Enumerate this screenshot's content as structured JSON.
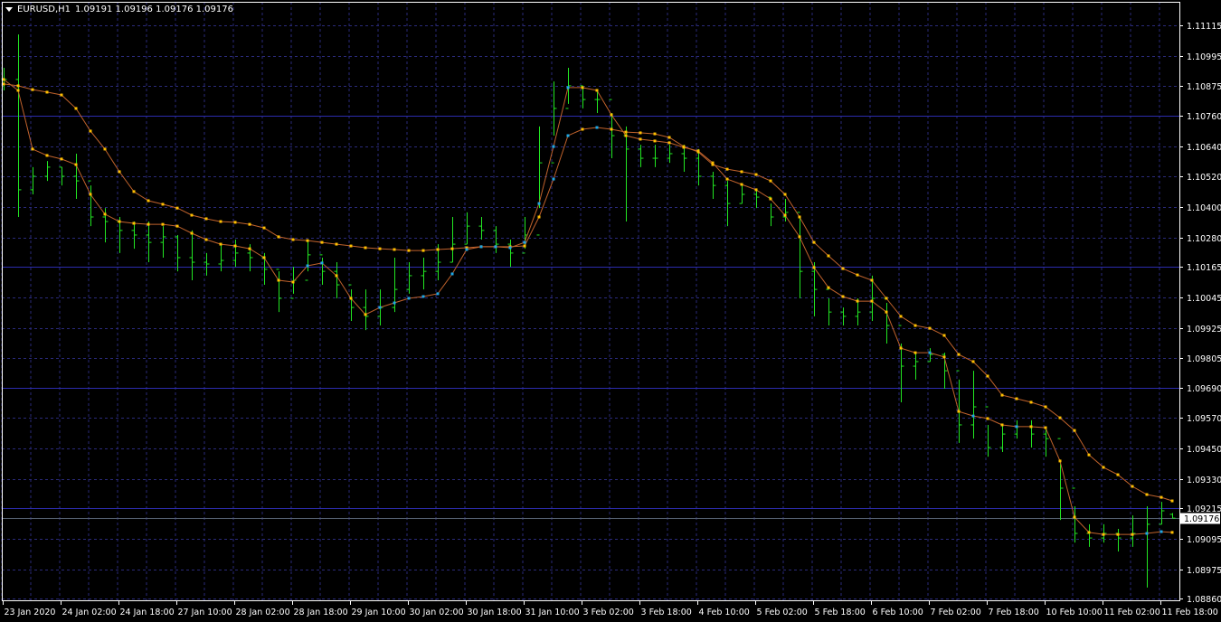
{
  "header": {
    "symbol": "EURUSD,H1",
    "ohlc": "1.09191 1.09196 1.09176 1.09176",
    "menu_icon": "triangle-down-icon"
  },
  "colors": {
    "background": "#000000",
    "bars": "#22e622",
    "grid": "#2a2a7a",
    "level_lines": "#2c2cae",
    "current_price_line": "#556070",
    "indicator_line": "#c0622c",
    "dot_down": "#ffc000",
    "dot_up": "#1ea8e6",
    "frame": "#ffffff"
  },
  "chart_data": {
    "type": "ohlc-bar",
    "symbol": "EURUSD",
    "timeframe": "H1",
    "ylim": [
      1.0886,
      1.11115
    ],
    "grid": true,
    "current_price": "1.09176",
    "y_ticks": [
      "1.11115",
      "1.10995",
      "1.10875",
      "1.10760",
      "1.10640",
      "1.10520",
      "1.10400",
      "1.10280",
      "1.10165",
      "1.10045",
      "1.09925",
      "1.09805",
      "1.09690",
      "1.09570",
      "1.09450",
      "1.09330",
      "1.09215",
      "1.09095",
      "1.08975",
      "1.08860"
    ],
    "x_ticks": [
      "23 Jan 2020",
      "24 Jan 02:00",
      "24 Jan 18:00",
      "27 Jan 10:00",
      "28 Jan 02:00",
      "28 Jan 18:00",
      "29 Jan 10:00",
      "30 Jan 02:00",
      "30 Jan 18:00",
      "31 Jan 10:00",
      "3 Feb 02:00",
      "3 Feb 18:00",
      "4 Feb 10:00",
      "5 Feb 02:00",
      "5 Feb 18:00",
      "6 Feb 10:00",
      "7 Feb 02:00",
      "7 Feb 18:00",
      "10 Feb 10:00",
      "11 Feb 02:00",
      "11 Feb 18:00"
    ],
    "levels": [
      1.1076,
      1.10165,
      1.0969,
      1.09215
    ],
    "time": [
      "23 Jan 10:00",
      "23 Jan 14:00",
      "23 Jan 18:00",
      "23 Jan 22:00",
      "24 Jan 02:00",
      "24 Jan 06:00",
      "24 Jan 10:00",
      "24 Jan 14:00",
      "24 Jan 18:00",
      "24 Jan 22:00",
      "27 Jan 02:00",
      "27 Jan 06:00",
      "27 Jan 10:00",
      "27 Jan 14:00",
      "27 Jan 18:00",
      "27 Jan 22:00",
      "28 Jan 02:00",
      "28 Jan 06:00",
      "28 Jan 10:00",
      "28 Jan 14:00",
      "28 Jan 18:00",
      "28 Jan 22:00",
      "29 Jan 02:00",
      "29 Jan 06:00",
      "29 Jan 10:00",
      "29 Jan 14:00",
      "29 Jan 18:00",
      "29 Jan 22:00",
      "30 Jan 02:00",
      "30 Jan 06:00",
      "30 Jan 10:00",
      "30 Jan 14:00",
      "30 Jan 18:00",
      "30 Jan 22:00",
      "31 Jan 02:00",
      "31 Jan 06:00",
      "31 Jan 10:00",
      "31 Jan 14:00",
      "31 Jan 18:00",
      "31 Jan 22:00",
      "3 Feb 02:00",
      "3 Feb 06:00",
      "3 Feb 10:00",
      "3 Feb 14:00",
      "3 Feb 18:00",
      "3 Feb 22:00",
      "4 Feb 02:00",
      "4 Feb 06:00",
      "4 Feb 10:00",
      "4 Feb 14:00",
      "4 Feb 18:00",
      "4 Feb 22:00",
      "5 Feb 02:00",
      "5 Feb 06:00",
      "5 Feb 10:00",
      "5 Feb 14:00",
      "5 Feb 18:00",
      "5 Feb 22:00",
      "6 Feb 02:00",
      "6 Feb 06:00",
      "6 Feb 10:00",
      "6 Feb 14:00",
      "6 Feb 18:00",
      "6 Feb 22:00",
      "7 Feb 02:00",
      "7 Feb 06:00",
      "7 Feb 10:00",
      "7 Feb 14:00",
      "7 Feb 18:00",
      "7 Feb 22:00",
      "10 Feb 02:00",
      "10 Feb 06:00",
      "10 Feb 10:00",
      "10 Feb 14:00",
      "10 Feb 18:00",
      "10 Feb 22:00",
      "11 Feb 02:00",
      "11 Feb 06:00",
      "11 Feb 10:00",
      "11 Feb 14:00",
      "11 Feb 18:00",
      "11 Feb 21:00"
    ],
    "high": [
      1.10948,
      1.11079,
      1.10557,
      1.10581,
      1.10557,
      1.1061,
      1.10485,
      1.10396,
      1.10361,
      1.10343,
      1.10343,
      1.10325,
      1.1029,
      1.10308,
      1.10219,
      1.10254,
      1.10272,
      1.10254,
      1.10219,
      1.10147,
      1.10165,
      1.10272,
      1.10201,
      1.10183,
      1.10076,
      1.10076,
      1.10076,
      1.10201,
      1.10183,
      1.10201,
      1.10254,
      1.10361,
      1.10379,
      1.10361,
      1.10325,
      1.10272,
      1.10361,
      1.10717,
      1.10894,
      1.10948,
      1.10877,
      1.10859,
      1.1077,
      1.10717,
      1.10645,
      1.10645,
      1.10645,
      1.10645,
      1.10628,
      1.10539,
      1.10503,
      1.10485,
      1.10468,
      1.10414,
      1.10432,
      1.10361,
      1.10183,
      1.10041,
      1.10005,
      1.10041,
      1.1013,
      1.10023,
      1.09863,
      1.09827,
      1.09845,
      1.09827,
      1.09721,
      1.09756,
      1.09543,
      1.09543,
      1.09561,
      1.09561,
      1.09525,
      1.09401,
      1.09223,
      1.09152,
      1.09152,
      1.09134,
      1.09187,
      1.09223,
      1.0924,
      1.09196
    ],
    "low": [
      1.10859,
      1.10361,
      1.1045,
      1.10503,
      1.10485,
      1.10432,
      1.10325,
      1.10261,
      1.10219,
      1.10236,
      1.10183,
      1.10201,
      1.10147,
      1.10112,
      1.1013,
      1.10147,
      1.10165,
      1.10147,
      1.10094,
      1.09987,
      1.10059,
      1.10147,
      1.10094,
      1.10041,
      1.09952,
      1.09916,
      1.09934,
      1.09987,
      1.10059,
      1.10076,
      1.10112,
      1.10183,
      1.10254,
      1.10272,
      1.10219,
      1.10165,
      1.10236,
      1.10396,
      1.10681,
      1.10806,
      1.10788,
      1.1077,
      1.10592,
      1.10343,
      1.10557,
      1.10557,
      1.10574,
      1.10539,
      1.10485,
      1.10432,
      1.10325,
      1.10414,
      1.10396,
      1.10325,
      1.10343,
      1.10041,
      1.0997,
      1.09934,
      1.09934,
      1.09934,
      1.09952,
      1.09863,
      1.09632,
      1.09721,
      1.09792,
      1.09685,
      1.09472,
      1.09489,
      1.09418,
      1.09436,
      1.09489,
      1.09454,
      1.09418,
      1.09169,
      1.0908,
      1.09063,
      1.0908,
      1.09045,
      1.09063,
      1.08903,
      1.09152,
      1.09176
    ],
    "close": [
      1.10902,
      1.10468,
      1.10521,
      1.10557,
      1.10521,
      1.10503,
      1.10361,
      1.10343,
      1.10308,
      1.1029,
      1.10261,
      1.10283,
      1.10201,
      1.10183,
      1.10176,
      1.1019,
      1.10219,
      1.10201,
      1.10155,
      1.10041,
      1.10112,
      1.10212,
      1.10147,
      1.10094,
      1.10005,
      1.0997,
      1.10005,
      1.10076,
      1.1013,
      1.10147,
      1.10183,
      1.10254,
      1.10325,
      1.10308,
      1.10254,
      1.10219,
      1.1029,
      1.10574,
      1.10788,
      1.10877,
      1.10823,
      1.10823,
      1.10681,
      1.10628,
      1.10592,
      1.10592,
      1.1061,
      1.10592,
      1.10521,
      1.10485,
      1.10414,
      1.1045,
      1.10439,
      1.10361,
      1.10379,
      1.10147,
      1.10076,
      1.09987,
      1.0997,
      1.09987,
      1.10041,
      1.09934,
      1.09774,
      1.09792,
      1.0982,
      1.09756,
      1.09543,
      1.09614,
      1.09454,
      1.09507,
      1.09536,
      1.09507,
      1.09489,
      1.09294,
      1.09116,
      1.09098,
      1.09116,
      1.09098,
      1.09116,
      1.09152,
      1.09205,
      1.09176
    ],
    "last_bar": {
      "open": 1.09191,
      "high": 1.09196,
      "low": 1.09176,
      "close": 1.09176
    },
    "indicators": [
      {
        "style": "line-with-dots",
        "values": [
          1.10884,
          1.10877,
          1.10862,
          1.10852,
          1.10841,
          1.10788,
          1.10699,
          1.10628,
          1.10539,
          1.10461,
          1.10425,
          1.10411,
          1.10396,
          1.10368,
          1.10354,
          1.10343,
          1.1034,
          1.10332,
          1.10318,
          1.10283,
          1.10272,
          1.10268,
          1.10261,
          1.10254,
          1.10247,
          1.1024,
          1.10236,
          1.10233,
          1.10229,
          1.10229,
          1.10233,
          1.10236,
          1.1024,
          1.10244,
          1.10244,
          1.10244,
          1.10247,
          1.10361,
          1.1051,
          1.10681,
          1.10706,
          1.10713,
          1.10706,
          1.10695,
          1.10692,
          1.10688,
          1.10674,
          1.10638,
          1.10617,
          1.10567,
          1.10549,
          1.10539,
          1.10528,
          1.10503,
          1.1045,
          1.10361,
          1.10261,
          1.10208,
          1.10158,
          1.10133,
          1.10112,
          1.10041,
          1.0997,
          1.09934,
          1.09923,
          1.09895,
          1.0982,
          1.09792,
          1.09735,
          1.0966,
          1.09646,
          1.09632,
          1.09614,
          1.09571,
          1.09521,
          1.09425,
          1.09376,
          1.09347,
          1.09301,
          1.09269,
          1.09258,
          1.09244
        ],
        "up_points": [
          38,
          39,
          41
        ]
      },
      {
        "style": "line-with-dots",
        "values": [
          1.10902,
          1.10859,
          1.10628,
          1.10603,
          1.10589,
          1.10567,
          1.1045,
          1.10372,
          1.10343,
          1.10336,
          1.10332,
          1.10332,
          1.10325,
          1.10297,
          1.10272,
          1.10254,
          1.10247,
          1.10236,
          1.10201,
          1.10112,
          1.10105,
          1.10169,
          1.1018,
          1.1013,
          1.10041,
          1.09977,
          1.10005,
          1.10023,
          1.10041,
          1.10048,
          1.10059,
          1.10137,
          1.10233,
          1.10244,
          1.10244,
          1.1024,
          1.10261,
          1.10414,
          1.10638,
          1.1087,
          1.1087,
          1.10859,
          1.10763,
          1.10681,
          1.10667,
          1.1066,
          1.10653,
          1.10635,
          1.10621,
          1.10574,
          1.1051,
          1.10489,
          1.10468,
          1.10432,
          1.10368,
          1.10283,
          1.10162,
          1.10083,
          1.10048,
          1.1003,
          1.1003,
          1.09987,
          1.09845,
          1.09827,
          1.09827,
          1.0981,
          1.09596,
          1.09578,
          1.09568,
          1.09543,
          1.09536,
          1.09536,
          1.09532,
          1.09401,
          1.0918,
          1.0912,
          1.09112,
          1.09112,
          1.09112,
          1.09116,
          1.09123,
          1.0912
        ],
        "up_points": [
          21,
          22,
          26,
          27,
          28,
          29,
          30,
          31,
          32,
          33,
          34,
          35,
          36,
          37,
          38,
          39,
          64,
          67,
          70,
          79,
          80
        ]
      }
    ]
  }
}
